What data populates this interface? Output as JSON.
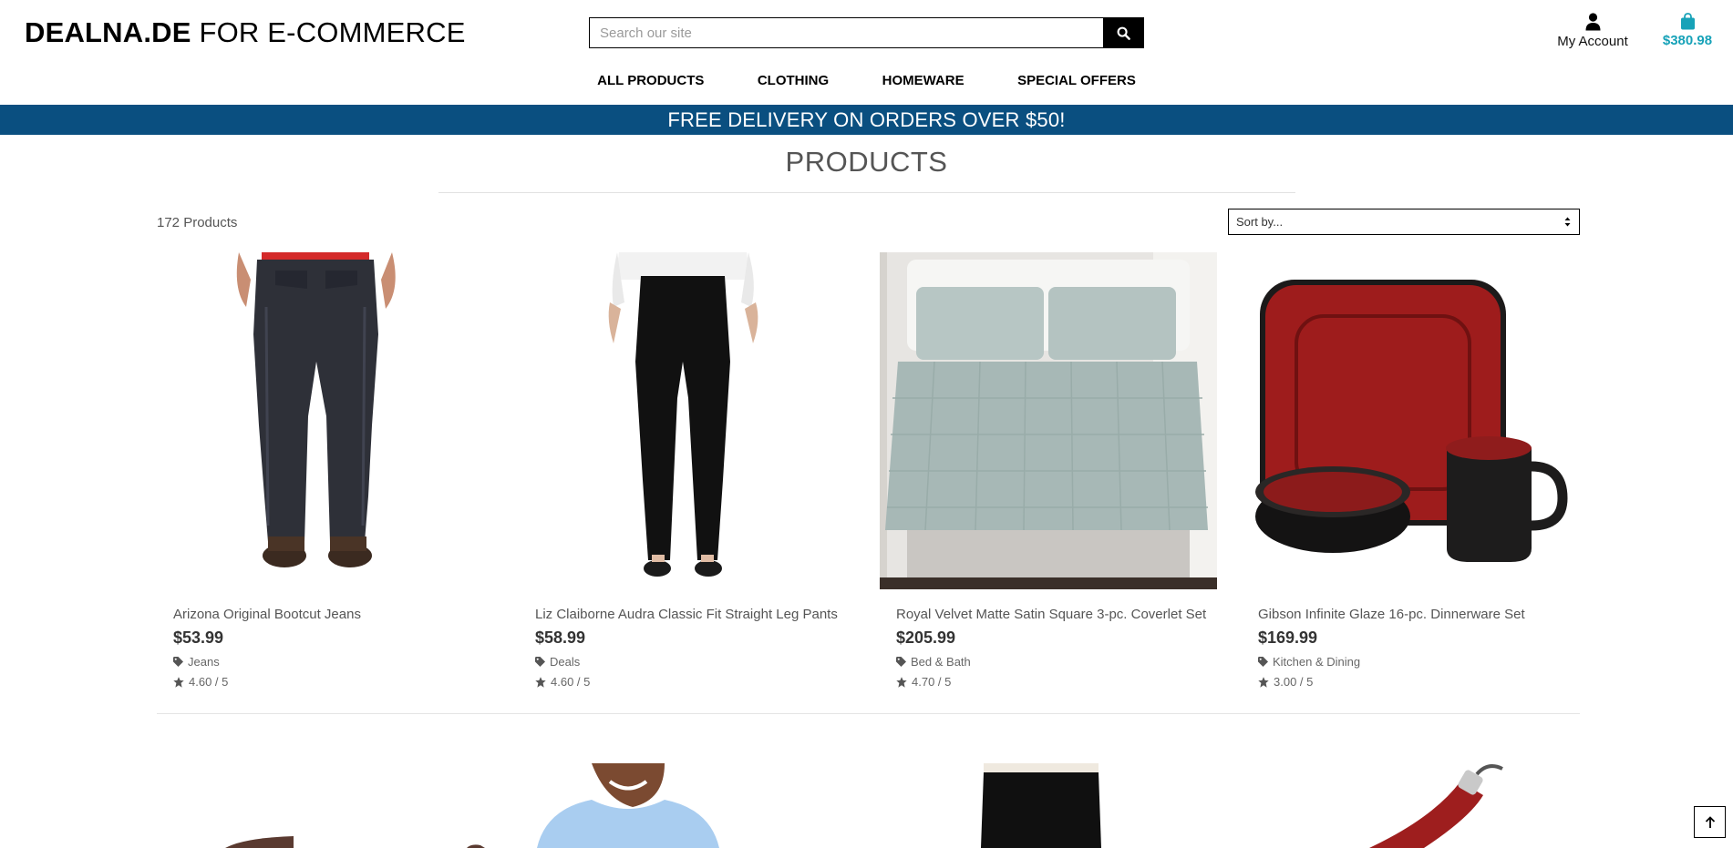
{
  "header": {
    "logo_bold": "DEALNA.DE",
    "logo_rest": " FOR E-COMMERCE",
    "search": {
      "placeholder": "Search our site",
      "value": "",
      "button_icon": "search-icon"
    },
    "account_label": "My Account",
    "account_icon": "user-icon",
    "cart_total": "$380.98",
    "cart_icon": "shopping-bag-icon",
    "cart_color": "#17a2b8"
  },
  "nav": [
    {
      "label": "ALL PRODUCTS"
    },
    {
      "label": "CLOTHING"
    },
    {
      "label": "HOMEWARE"
    },
    {
      "label": "SPECIAL OFFERS"
    }
  ],
  "banner": {
    "text": "FREE DELIVERY ON ORDERS OVER $50!",
    "color": "#0a4f80"
  },
  "main": {
    "title": "PRODUCTS",
    "count": "172 Products",
    "sort": {
      "selected": "Sort by..."
    }
  },
  "products": [
    {
      "name": "Arizona Original Bootcut Jeans",
      "price": "$53.99",
      "category": "Jeans",
      "rating": "4.60 / 5"
    },
    {
      "name": "Liz Claiborne Audra Classic Fit Straight Leg Pants",
      "price": "$58.99",
      "category": "Deals",
      "rating": "4.60 / 5"
    },
    {
      "name": "Royal Velvet Matte Satin Square 3-pc. Coverlet Set",
      "price": "$205.99",
      "category": "Bed & Bath",
      "rating": "4.70 / 5"
    },
    {
      "name": "Gibson Infinite Glaze 16-pc. Dinnerware Set",
      "price": "$169.99",
      "category": "Kitchen & Dining",
      "rating": "3.00 / 5"
    }
  ],
  "back_to_top_icon": "arrow-up-icon"
}
